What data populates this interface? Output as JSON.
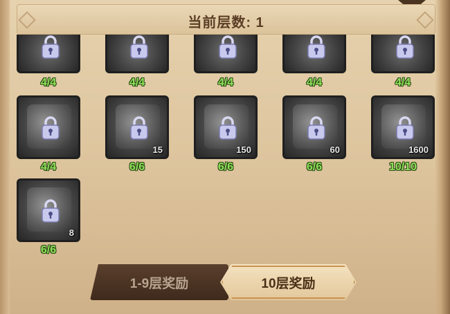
{
  "header": {
    "title": "当前层数: 1"
  },
  "rows": [
    {
      "items": [
        {
          "count": "4/4",
          "qty": ""
        },
        {
          "count": "4/4",
          "qty": ""
        },
        {
          "count": "4/4",
          "qty": ""
        },
        {
          "count": "4/4",
          "qty": ""
        },
        {
          "count": "4/4",
          "qty": ""
        }
      ]
    },
    {
      "items": [
        {
          "count": "4/4",
          "qty": ""
        },
        {
          "count": "6/6",
          "qty": "15"
        },
        {
          "count": "6/6",
          "qty": "150"
        },
        {
          "count": "6/6",
          "qty": "60"
        },
        {
          "count": "10/10",
          "qty": "1600"
        }
      ]
    },
    {
      "items": [
        {
          "count": "6/6",
          "qty": "8"
        }
      ]
    }
  ],
  "tabs": {
    "floors_1_9": "1-9层奖励",
    "floor_10": "10层奖励"
  },
  "colors": {
    "count_green": "#8fe05a",
    "active_tab": "#f4e2c0",
    "inactive_tab": "#4a3422"
  }
}
